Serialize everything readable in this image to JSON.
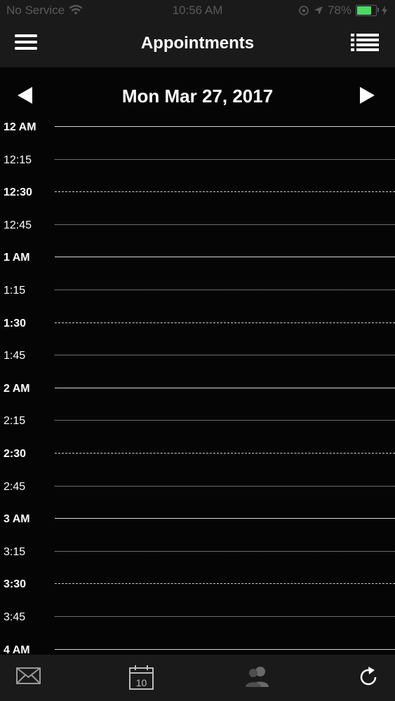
{
  "status_bar": {
    "carrier": "No Service",
    "time": "10:56 AM",
    "battery": "78%",
    "battery_level": 0.78,
    "icons": [
      "wifi-icon",
      "orientation-lock-icon",
      "location-arrow-icon",
      "battery-icon",
      "charging-bolt-icon"
    ]
  },
  "nav": {
    "title": "Appointments",
    "left_icon": "hamburger-menu-icon",
    "right_icon": "list-view-icon"
  },
  "date_header": {
    "date": "Mon Mar 27, 2017",
    "prev_icon": "left-triangle-icon",
    "next_icon": "right-triangle-icon"
  },
  "time_slots": [
    {
      "label": "12 AM",
      "kind": "hour"
    },
    {
      "label": "12:15",
      "kind": "quarter"
    },
    {
      "label": "12:30",
      "kind": "half"
    },
    {
      "label": "12:45",
      "kind": "quarter"
    },
    {
      "label": "1 AM",
      "kind": "hour"
    },
    {
      "label": "1:15",
      "kind": "quarter"
    },
    {
      "label": "1:30",
      "kind": "half"
    },
    {
      "label": "1:45",
      "kind": "quarter"
    },
    {
      "label": "2 AM",
      "kind": "hour"
    },
    {
      "label": "2:15",
      "kind": "quarter"
    },
    {
      "label": "2:30",
      "kind": "half"
    },
    {
      "label": "2:45",
      "kind": "quarter"
    },
    {
      "label": "3 AM",
      "kind": "hour"
    },
    {
      "label": "3:15",
      "kind": "quarter"
    },
    {
      "label": "3:30",
      "kind": "half"
    },
    {
      "label": "3:45",
      "kind": "quarter"
    },
    {
      "label": "4 AM",
      "kind": "hour"
    }
  ],
  "tab_bar": {
    "items": [
      {
        "name": "mail",
        "icon": "envelope-icon"
      },
      {
        "name": "calendar",
        "icon": "calendar-icon",
        "calendar_day": "10"
      },
      {
        "name": "contacts",
        "icon": "contacts-icon"
      },
      {
        "name": "refresh",
        "icon": "refresh-icon"
      }
    ]
  },
  "colors": {
    "background": "#050505",
    "bars": "#1a1a1a",
    "text": "#ffffff",
    "status_text": "#5a5a5a",
    "battery_green": "#4cd964",
    "grid_lines": "#d8d8d8",
    "inactive_tab": "#6a6a6a"
  }
}
